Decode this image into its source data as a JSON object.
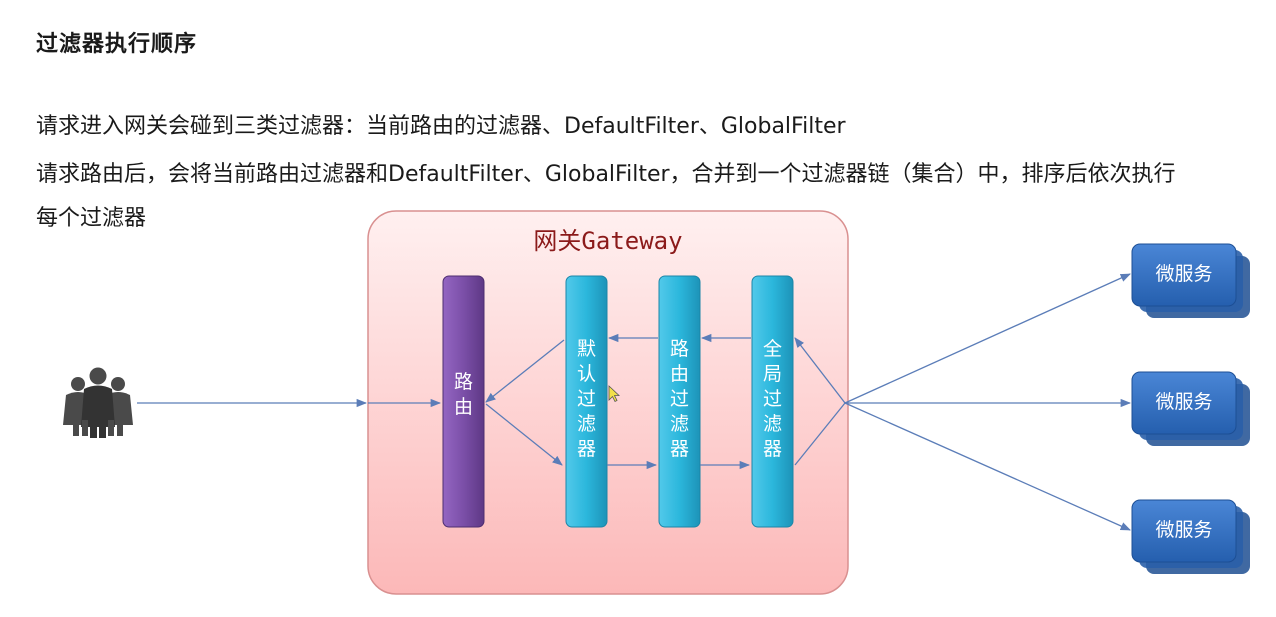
{
  "title": "过滤器执行顺序",
  "lines": [
    "请求进入网关会碰到三类过滤器：当前路由的过滤器、DefaultFilter、GlobalFilter",
    "请求路由后，会将当前路由过滤器和DefaultFilter、GlobalFilter，合并到一个过滤器链（集合）中，排序后依次执行",
    "每个过滤器"
  ],
  "diagram": {
    "gateway_label": "网关Gateway",
    "bars": [
      {
        "label": "路由",
        "chars": [
          "路",
          "由"
        ],
        "color": "#7b4fa8"
      },
      {
        "label": "默认过滤器",
        "chars": [
          "默",
          "认",
          "过",
          "滤",
          "器"
        ],
        "color": "#29b3d8"
      },
      {
        "label": "路由过滤器",
        "chars": [
          "路",
          "由",
          "过",
          "滤",
          "器"
        ],
        "color": "#29b3d8"
      },
      {
        "label": "全局过滤器",
        "chars": [
          "全",
          "局",
          "过",
          "滤",
          "器"
        ],
        "color": "#29b3d8"
      }
    ],
    "services": [
      "微服务",
      "微服务",
      "微服务"
    ],
    "users_icon": "users-group-icon",
    "colors": {
      "gateway_fill": "#fdd5d5",
      "gateway_stroke": "#d99090",
      "service_fill": "#2f6fc0",
      "arrow": "#5b7db8"
    }
  }
}
